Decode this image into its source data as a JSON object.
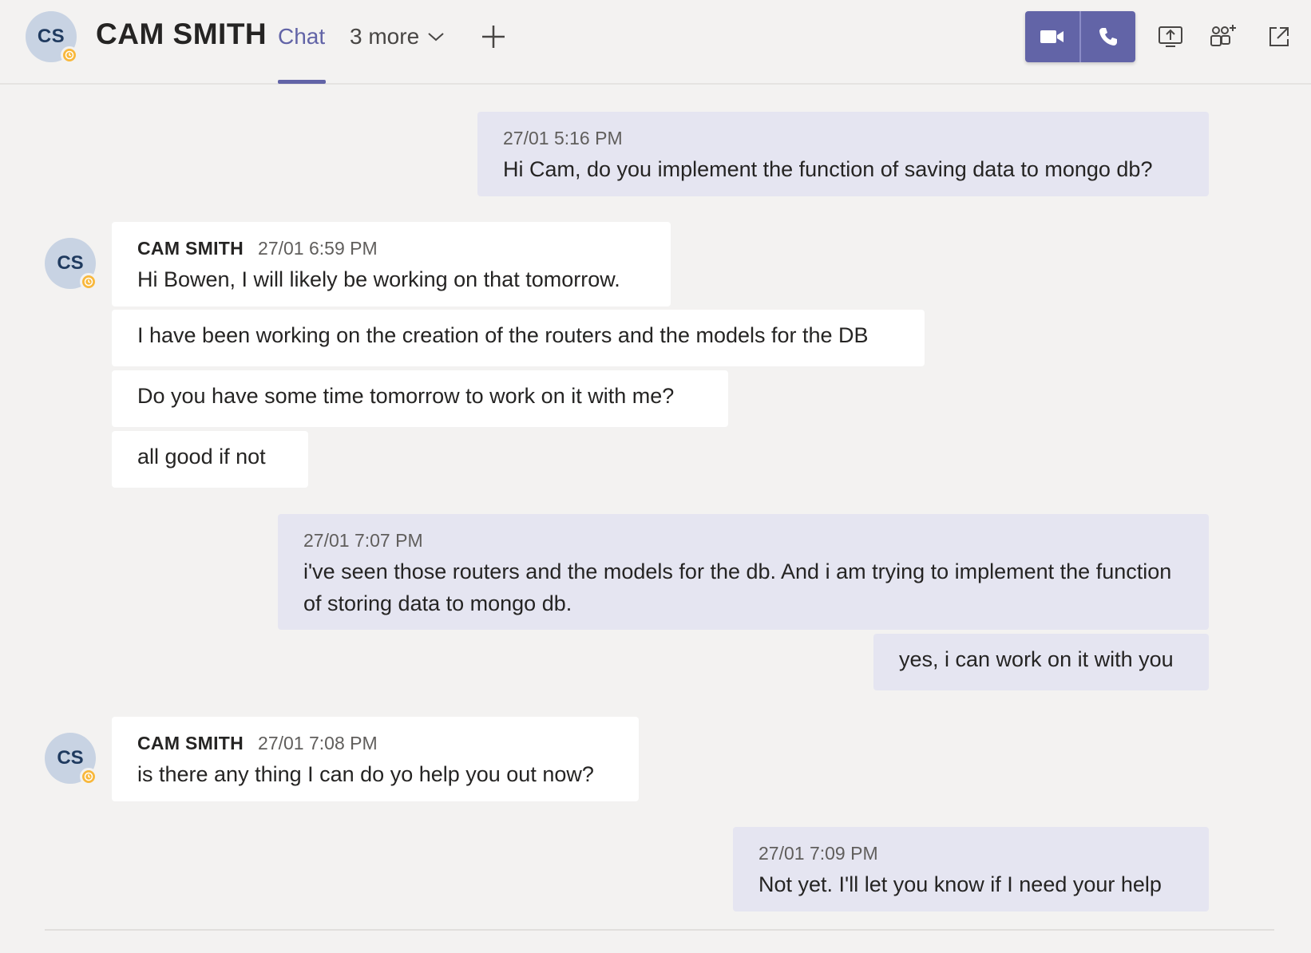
{
  "header": {
    "avatar_initials": "CS",
    "contact_name": "CAM SMITH",
    "tabs": [
      {
        "label": "Chat",
        "active": true
      }
    ],
    "more_tabs_label": "3 more",
    "accent_color": "#6264a7",
    "away_status_color": "#f8b83c",
    "icons": [
      "video-call-icon",
      "audio-call-icon",
      "share-screen-icon",
      "add-people-icon",
      "pop-out-icon"
    ]
  },
  "messages": [
    {
      "from": "me",
      "time": "27/01 5:16 PM",
      "text": "Hi Cam, do you implement the function of saving data to mongo db?"
    },
    {
      "from": "them",
      "sender": "CAM SMITH",
      "time": "27/01 6:59 PM",
      "text": "Hi Bowen, I will likely be working on that tomorrow."
    },
    {
      "from": "them",
      "text": "I have been working on the creation of the routers and the models for the DB"
    },
    {
      "from": "them",
      "text": "Do you have some time tomorrow to work on it with me?"
    },
    {
      "from": "them",
      "text": "all good if not"
    },
    {
      "from": "me",
      "time": "27/01 7:07 PM",
      "text": "i've seen those routers and the models for the db. And i am trying to implement the function of storing data to mongo db."
    },
    {
      "from": "me",
      "text": "yes, i can work on it with you"
    },
    {
      "from": "them",
      "sender": "CAM SMITH",
      "time": "27/01 7:08 PM",
      "text": "is there any thing I can do yo help you out now?"
    },
    {
      "from": "me",
      "time": "27/01 7:09 PM",
      "text": "Not yet. I'll let you know if I need your help"
    }
  ]
}
